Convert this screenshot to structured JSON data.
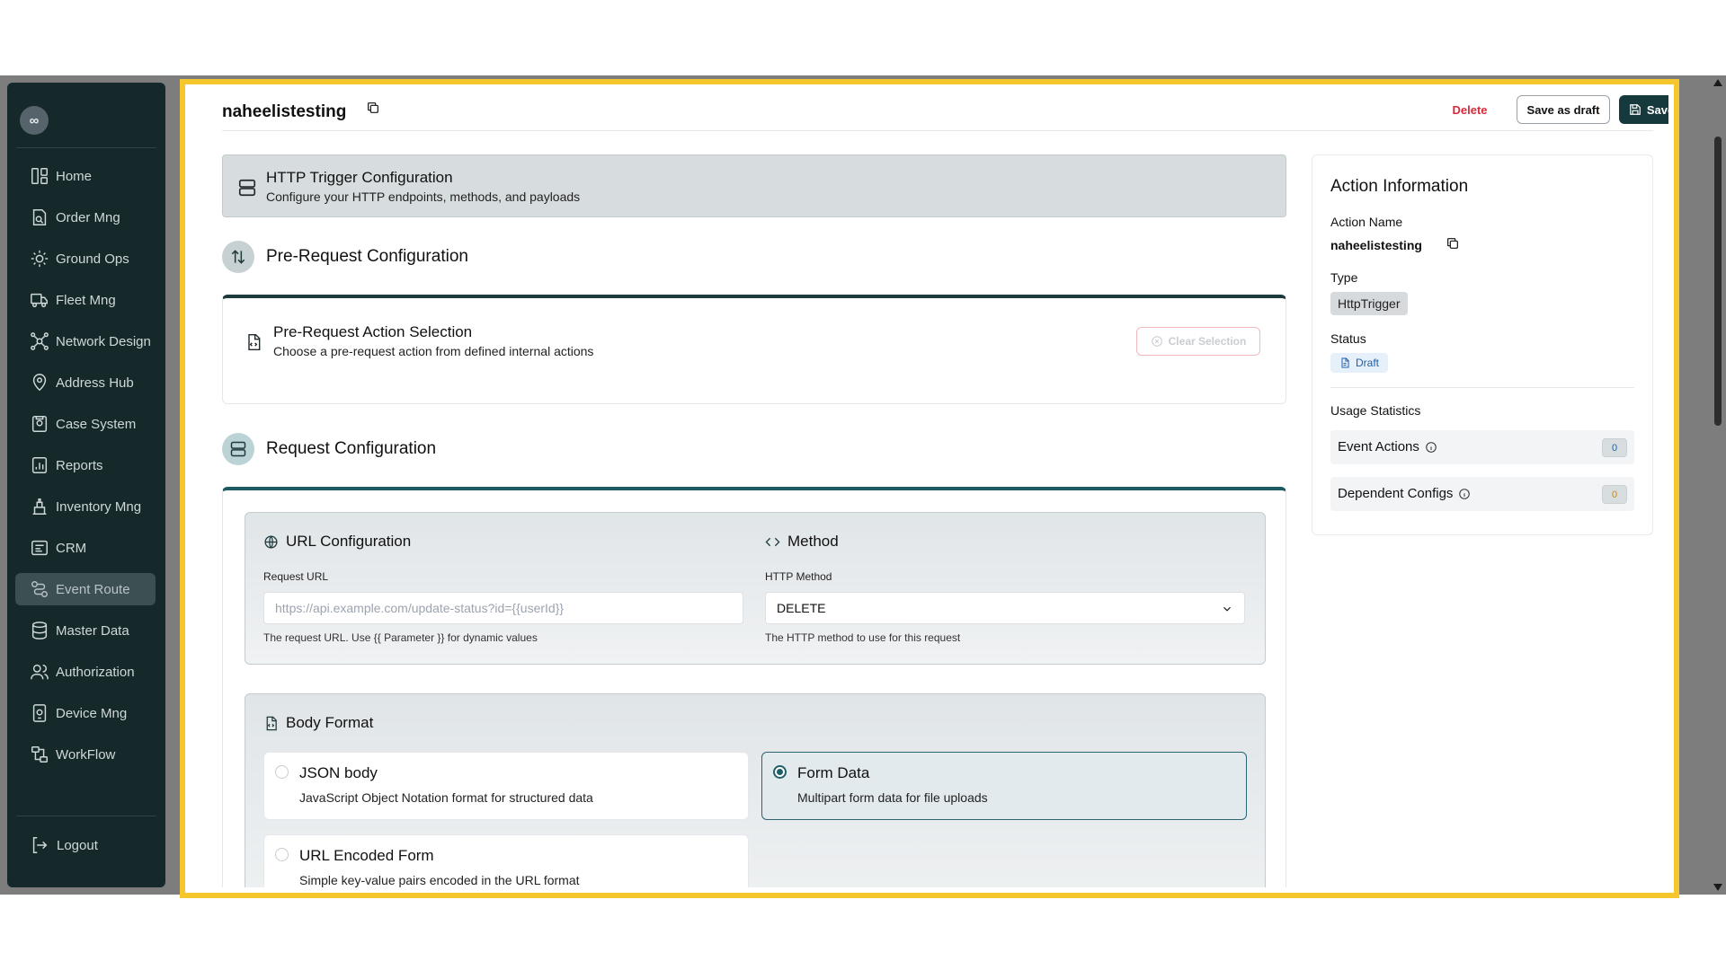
{
  "sidebar": {
    "logo": "∞",
    "items": [
      {
        "label": "Home",
        "icon": "home-layout-icon"
      },
      {
        "label": "Order Mng",
        "icon": "order-icon"
      },
      {
        "label": "Ground Ops",
        "icon": "ground-ops-icon"
      },
      {
        "label": "Fleet Mng",
        "icon": "truck-icon"
      },
      {
        "label": "Network Design",
        "icon": "network-icon"
      },
      {
        "label": "Address Hub",
        "icon": "map-pin-icon"
      },
      {
        "label": "Case System",
        "icon": "case-icon"
      },
      {
        "label": "Reports",
        "icon": "report-icon"
      },
      {
        "label": "Inventory Mng",
        "icon": "inventory-icon"
      },
      {
        "label": "CRM",
        "icon": "crm-icon"
      },
      {
        "label": "Event Route",
        "icon": "route-icon",
        "active": true
      },
      {
        "label": "Master Data",
        "icon": "database-icon"
      },
      {
        "label": "Authorization",
        "icon": "users-icon"
      },
      {
        "label": "Device Mng",
        "icon": "device-icon"
      },
      {
        "label": "WorkFlow",
        "icon": "workflow-icon"
      }
    ],
    "logout": "Logout"
  },
  "header": {
    "title": "naheelistesting",
    "delete_label": "Delete",
    "draft_label": "Save as draft",
    "save_label": "Save"
  },
  "banner": {
    "title": "HTTP Trigger Configuration",
    "subtitle": "Configure your HTTP endpoints, methods, and payloads"
  },
  "pre_request": {
    "section_title": "Pre-Request Configuration",
    "card_title": "Pre-Request Action Selection",
    "card_subtitle": "Choose a pre-request action from defined internal actions",
    "clear_label": "Clear Selection"
  },
  "request": {
    "section_title": "Request Configuration",
    "url": {
      "heading": "URL Configuration",
      "label": "Request URL",
      "placeholder": "https://api.example.com/update-status?id={{userId}}",
      "hint": "The request URL. Use {{ Parameter }} for dynamic values"
    },
    "method": {
      "heading": "Method",
      "label": "HTTP Method",
      "value": "DELETE",
      "hint": "The HTTP method to use for this request"
    },
    "body": {
      "heading": "Body Format",
      "options": [
        {
          "title": "JSON body",
          "subtitle": "JavaScript Object Notation format for structured data",
          "selected": false
        },
        {
          "title": "Form Data",
          "subtitle": "Multipart form data for file uploads",
          "selected": true
        },
        {
          "title": "URL Encoded Form",
          "subtitle": "Simple key-value pairs encoded in the URL format",
          "selected": false
        }
      ]
    }
  },
  "info": {
    "title": "Action Information",
    "name_label": "Action Name",
    "name_value": "naheelistesting",
    "type_label": "Type",
    "type_value": "HttpTrigger",
    "status_label": "Status",
    "status_value": "Draft",
    "usage_label": "Usage Statistics",
    "stats": [
      {
        "label": "Event Actions",
        "count": "0",
        "color": "#1f5fa8"
      },
      {
        "label": "Dependent Configs",
        "count": "0",
        "color": "#c98a12"
      }
    ]
  },
  "colors": {
    "sidebar_bg": "#15292a",
    "primary": "#15393c",
    "danger": "#d42b3c",
    "highlight_border": "#f5c72c"
  }
}
